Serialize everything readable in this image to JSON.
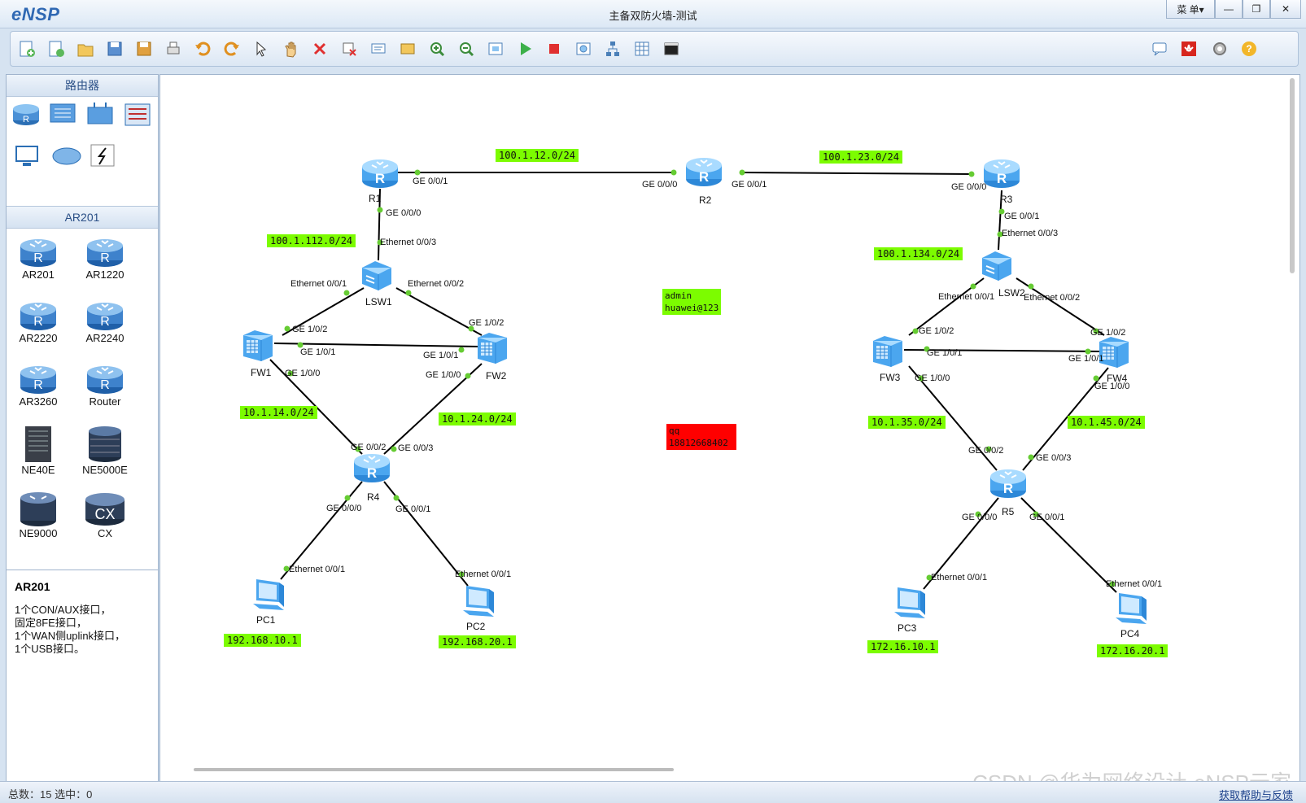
{
  "app": {
    "name": "eNSP",
    "window_title": "主备双防火墙-测试",
    "menu_label": "菜 单▾",
    "min_label": "—",
    "max_label": "❐",
    "close_label": "✕"
  },
  "toolbar": {
    "icons": [
      "new-topology-icon",
      "new-example-icon",
      "open-icon",
      "save-icon",
      "save-as-icon",
      "print-icon",
      "undo-icon",
      "redo-icon",
      "select-icon",
      "pan-hand-icon",
      "delete-icon",
      "delete-link-icon",
      "text-note-icon",
      "rectangle-icon",
      "zoom-in-icon",
      "zoom-out-icon",
      "fit-view-icon",
      "start-device-icon",
      "stop-device-icon",
      "capture-icon",
      "topology-icon",
      "grid-icon",
      "console-icon"
    ],
    "right_icons": [
      "chat-icon",
      "huawei-icon",
      "settings-icon",
      "help-icon"
    ]
  },
  "sidebar": {
    "category_title": "路由器",
    "subcategory_title": "AR201",
    "devices": [
      "AR201",
      "AR1220",
      "AR2220",
      "AR2240",
      "AR3260",
      "Router",
      "NE40E",
      "NE5000E",
      "NE9000",
      "CX"
    ],
    "description": {
      "title": "AR201",
      "lines": [
        "1个CON/AUX接口，",
        "固定8FE接口，",
        "1个WAN侧uplink接口，",
        "1个USB接口。"
      ]
    }
  },
  "topology": {
    "nodes": {
      "R1": "R1",
      "R2": "R2",
      "R3": "R3",
      "R4": "R4",
      "R5": "R5",
      "LSW1": "LSW1",
      "LSW2": "LSW2",
      "FW1": "FW1",
      "FW2": "FW2",
      "FW3": "FW3",
      "FW4": "FW4",
      "PC1": "PC1",
      "PC2": "PC2",
      "PC3": "PC3",
      "PC4": "PC4"
    },
    "ports": {
      "r1_g001": "GE 0/0/1",
      "r2_g000": "GE 0/0/0",
      "r2_g001": "GE 0/0/1",
      "r3_g000": "GE 0/0/0",
      "r1_g000": "GE 0/0/0",
      "lsw1_e003": "Ethernet 0/0/3",
      "lsw1_e001": "Ethernet 0/0/1",
      "lsw1_e002": "Ethernet 0/0/2",
      "fw1_g102": "GE 1/0/2",
      "fw1_g101": "GE 1/0/1",
      "fw1_g100": "GE 1/0/0",
      "fw2_g102": "GE 1/0/2",
      "fw2_g101": "GE 1/0/1",
      "fw2_g100": "GE 1/0/0",
      "r4_g002": "GE 0/0/2",
      "r4_g003": "GE 0/0/3",
      "r4_g000": "GE 0/0/0",
      "r4_g001": "GE 0/0/1",
      "pc1_e001": "Ethernet 0/0/1",
      "pc2_e001": "Ethernet 0/0/1",
      "r3_g001": "GE 0/0/1",
      "lsw2_e003": "Ethernet 0/0/3",
      "lsw2_e001": "Ethernet 0/0/1",
      "lsw2_e002": "Ethernet 0/0/2",
      "fw3_g102": "GE 1/0/2",
      "fw3_g101": "GE 1/0/1",
      "fw3_g100": "GE 1/0/0",
      "fw4_g102": "GE 1/0/2",
      "fw4_g101": "GE 1/0/1",
      "fw4_g100": "GE 1/0/0",
      "r5_g002": "GE 0/0/2",
      "r5_g003": "GE 0/0/3",
      "r5_g000": "GE 0/0/0",
      "r5_g001": "GE 0/0/1",
      "pc3_e001": "Ethernet 0/0/1",
      "pc4_e001": "Ethernet 0/0/1"
    },
    "networks": {
      "n12": "100.1.12.0/24",
      "n23": "100.1.23.0/24",
      "n112": "100.1.112.0/24",
      "n134": "100.1.134.0/24",
      "n14": "10.1.14.0/24",
      "n24": "10.1.24.0/24",
      "n35": "10.1.35.0/24",
      "n45": "10.1.45.0/24",
      "pc1": "192.168.10.1",
      "pc2": "192.168.20.1",
      "pc3": "172.16.10.1",
      "pc4": "172.16.20.1"
    },
    "notes": {
      "cred_user": "admin",
      "cred_pass": "huawei@123",
      "qq_label": "qq",
      "qq_number": "18812668402"
    },
    "colors": {
      "label_bg": "#7cfc00",
      "note_red": "#ff0000",
      "link": "#000000",
      "port_dot": "#66cc33"
    }
  },
  "statusbar": {
    "text": "总数：15  选中：0",
    "help_link": "获取帮助与反馈",
    "watermark": "CSDN @华为网络设计-eNSP云家"
  }
}
